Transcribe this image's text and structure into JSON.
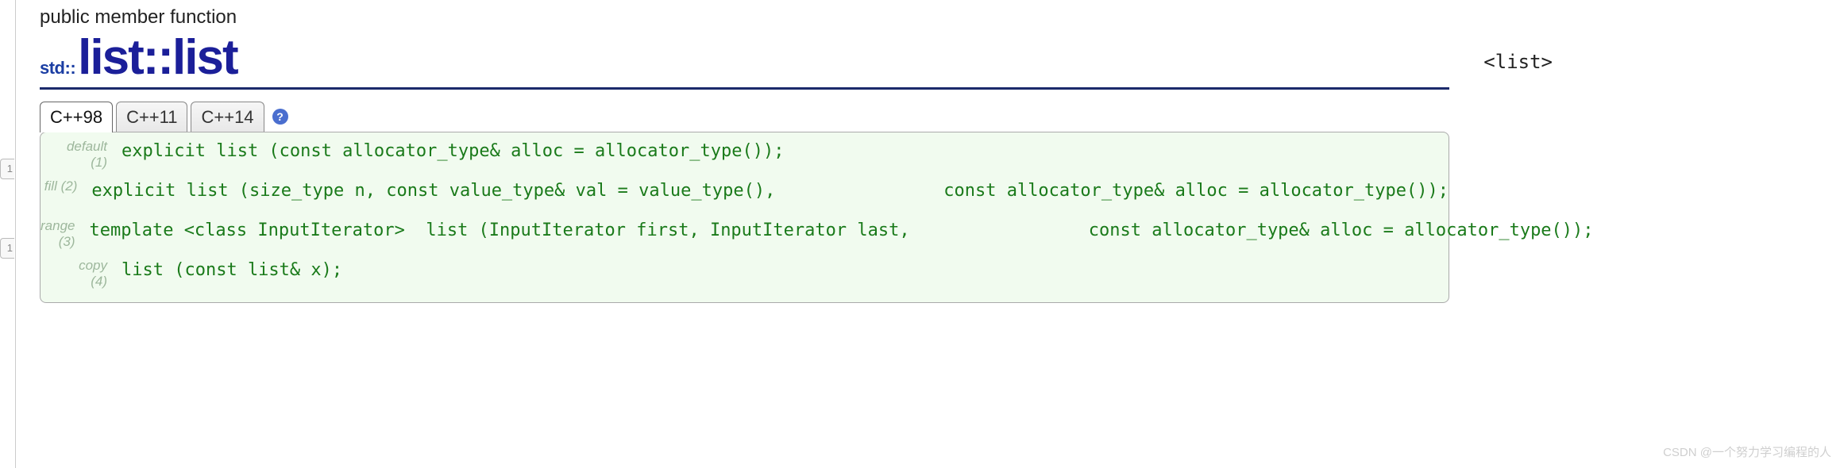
{
  "gutter_markers": [
    "1",
    "1"
  ],
  "category": "public member function",
  "namespace_prefix": "std::",
  "title": "list::list",
  "header_tag": "<list>",
  "tabs": [
    {
      "label": "C++98",
      "active": true
    },
    {
      "label": "C++11",
      "active": false
    },
    {
      "label": "C++14",
      "active": false
    }
  ],
  "help_glyph": "?",
  "signatures": [
    {
      "name": "default",
      "num": "(1)",
      "code": "explicit list (const allocator_type& alloc = allocator_type());"
    },
    {
      "name": "fill",
      "num": "(2)",
      "code": "explicit list (size_type n, const value_type& val = value_type(),                const allocator_type& alloc = allocator_type());"
    },
    {
      "name": "range",
      "num": "(3)",
      "code": "template <class InputIterator>  list (InputIterator first, InputIterator last,                 const allocator_type& alloc = allocator_type());"
    },
    {
      "name": "copy",
      "num": "(4)",
      "code": "list (const list& x);"
    }
  ],
  "watermark": "CSDN @一个努力学习编程的人"
}
